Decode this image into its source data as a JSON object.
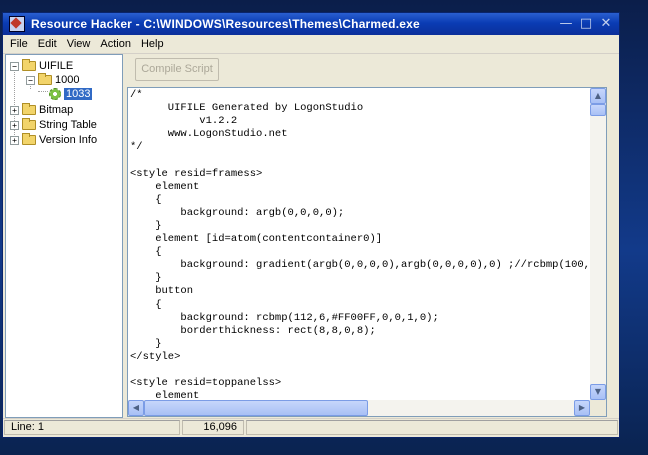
{
  "window": {
    "title": "Resource Hacker  -  C:\\WINDOWS\\Resources\\Themes\\Charmed.exe"
  },
  "title_buttons": {
    "minimize": "—",
    "maximize": "□",
    "close": "✕"
  },
  "menu": [
    "File",
    "Edit",
    "View",
    "Action",
    "Help"
  ],
  "tree": {
    "root": "UIFILE",
    "child": "1000",
    "leaf": "1033",
    "others": [
      "Bitmap",
      "String Table",
      "Version Info"
    ],
    "collapsed_glyph": "+",
    "expanded_glyph": "−"
  },
  "toolbar": {
    "compile_label": "Compile Script"
  },
  "editor": {
    "lines": [
      "/*",
      "      UIFILE Generated by LogonStudio",
      "           v1.2.2",
      "      www.LogonStudio.net",
      "*/",
      "",
      "<style resid=framess>",
      "    element",
      "    {",
      "        background: argb(0,0,0,0);",
      "    }",
      "    element [id=atom(contentcontainer0)]",
      "    {",
      "        background: gradient(argb(0,0,0,0),argb(0,0,0,0),0) ;//rcbmp(100,",
      "    }",
      "    button",
      "    {",
      "        background: rcbmp(112,6,#FF00FF,0,0,1,0);",
      "        borderthickness: rect(8,8,0,8);",
      "    }",
      "</style>",
      "",
      "<style resid=toppanelss>",
      "    element"
    ]
  },
  "scrollbars": {
    "up": "▲",
    "down": "▼",
    "left": "◀",
    "right": "▶"
  },
  "status": {
    "line": "Line: 1",
    "size": "16,096"
  }
}
